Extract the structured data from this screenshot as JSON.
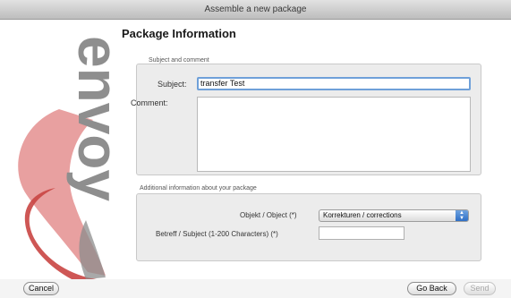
{
  "window": {
    "title": "Assemble a new package"
  },
  "sidebar": {
    "logo_text": "envoy"
  },
  "main": {
    "heading": "Package Information",
    "subject_group": {
      "label": "Subject and comment",
      "subject_label": "Subject:",
      "subject_value": "transfer Test",
      "comment_label": "Comment:",
      "comment_value": ""
    },
    "additional_group": {
      "label": "Additional information about your package",
      "objekt_label": "Objekt / Object (*)",
      "objekt_value": "Korrekturen / corrections",
      "betreff_label": "Betreff / Subject (1-200 Characters) (*)",
      "betreff_value": ""
    }
  },
  "footer": {
    "cancel_label": "Cancel",
    "go_back_label": "Go Back",
    "send_label": "Send"
  },
  "colors": {
    "focus_ring": "#6fa0d9",
    "logo_red": "#d9504f",
    "logo_pink": "#e8a0a0"
  }
}
